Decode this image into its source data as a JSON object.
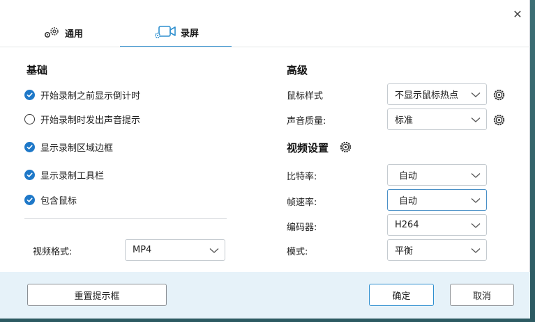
{
  "window": {
    "close_glyph": "✕"
  },
  "tabs": [
    {
      "label": "通用",
      "icon": "gear-icon"
    },
    {
      "label": "录屏",
      "icon": "video-camera-icon"
    }
  ],
  "basic": {
    "title": "基础",
    "options": [
      {
        "label": "开始录制之前显示倒计时",
        "checked": true
      },
      {
        "label": "开始录制时发出声音提示",
        "checked": false
      },
      {
        "label": "显示录制区域边框",
        "checked": true
      },
      {
        "label": "显示录制工具栏",
        "checked": true
      },
      {
        "label": "包含鼠标",
        "checked": true
      }
    ],
    "video_format": {
      "label": "视频格式:",
      "value": "MP4"
    }
  },
  "advanced": {
    "title": "高级",
    "mouse_style": {
      "label": "鼠标样式",
      "value": "不显示鼠标热点"
    },
    "sound_quality": {
      "label": "声音质量:",
      "value": "标准"
    }
  },
  "video_settings": {
    "title": "视频设置",
    "bitrate": {
      "label": "比特率:",
      "value": "自动"
    },
    "framerate": {
      "label": "帧速率:",
      "value": "自动"
    },
    "encoder": {
      "label": "编码器:",
      "value": "H264"
    },
    "mode": {
      "label": "模式:",
      "value": "平衡"
    }
  },
  "footer": {
    "reset_label": "重置提示框",
    "ok_label": "确定",
    "cancel_label": "取消"
  },
  "colors": {
    "accent": "#1e78c8",
    "footer_bg": "#e6f2f9",
    "tab_underline": "#2e8fcf"
  }
}
